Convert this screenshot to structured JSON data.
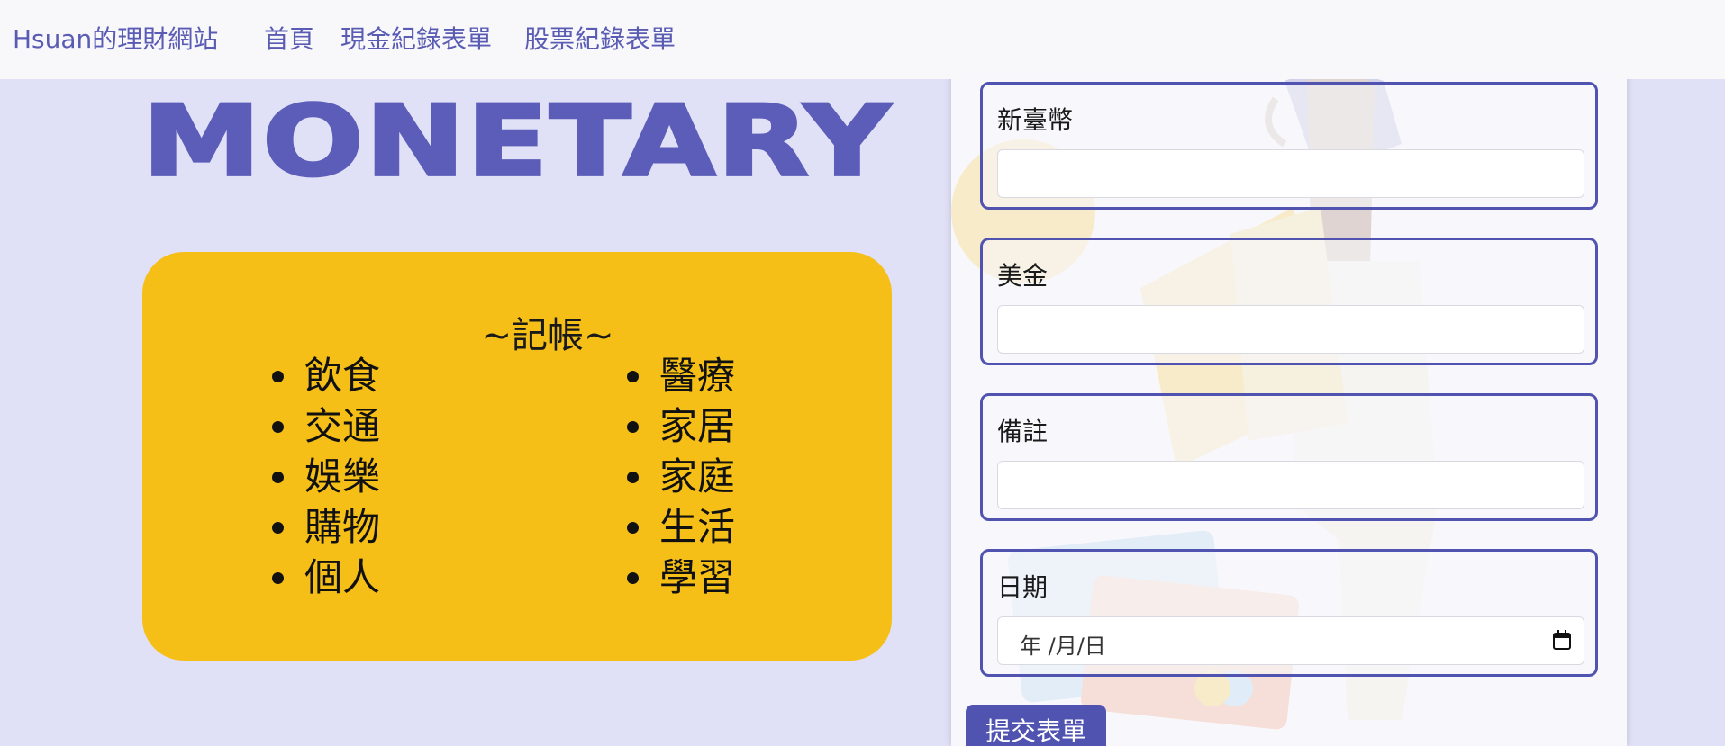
{
  "navbar": {
    "brand": "Hsuan的理財網站",
    "links": [
      "首頁",
      "現金紀錄表單",
      "股票紀錄表單"
    ]
  },
  "hero": {
    "title": "MONETARY"
  },
  "categories": {
    "heading": "~記帳~",
    "left": [
      "飲食",
      "交通",
      "娛樂",
      "購物",
      "個人"
    ],
    "right": [
      "醫療",
      "家居",
      "家庭",
      "生活",
      "學習"
    ]
  },
  "form": {
    "fields": [
      {
        "label": "新臺幣",
        "value": ""
      },
      {
        "label": "美金",
        "value": ""
      },
      {
        "label": "備註",
        "value": ""
      },
      {
        "label": "日期",
        "placeholder": "年 /月/日"
      }
    ],
    "submit_label": "提交表單"
  },
  "colors": {
    "accent": "#5054b0",
    "card": "#f5bf17",
    "background": "#e0e0f6"
  }
}
